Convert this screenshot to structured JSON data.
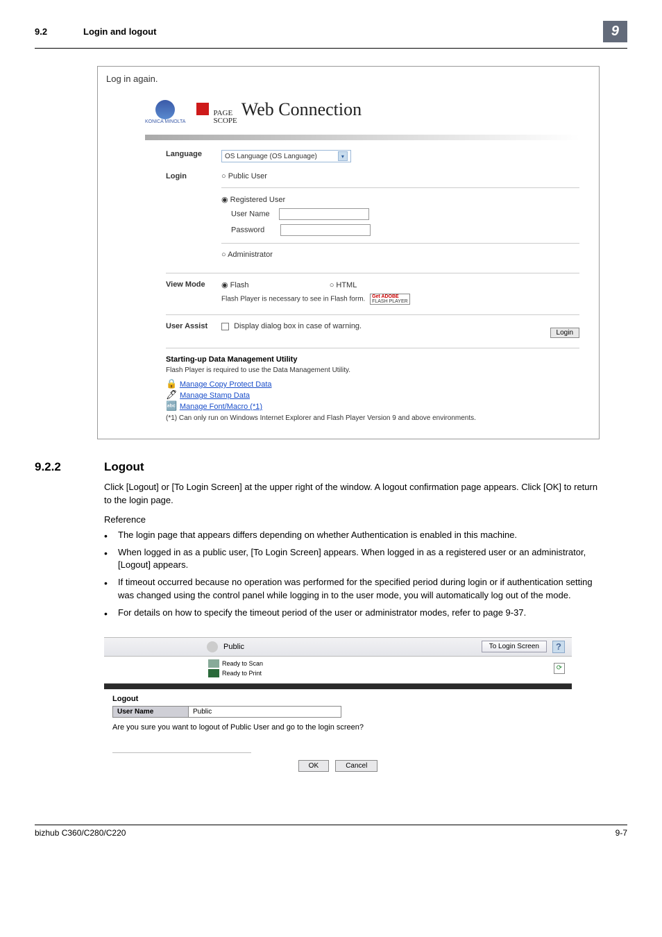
{
  "header": {
    "section_num": "9.2",
    "section_title": "Login and logout",
    "chapter": "9"
  },
  "panel1": {
    "caption": "Log in again.",
    "brand_sub": "KONICA MINOLTA",
    "brand_ps_line1": "PAGE",
    "brand_ps_line2": "SCOPE",
    "brand_wc": "Web Connection",
    "labels": {
      "language": "Language",
      "login": "Login",
      "view_mode": "View Mode",
      "user_assist": "User Assist"
    },
    "language_value": "OS Language (OS Language)",
    "login": {
      "public": "Public User",
      "registered": "Registered User",
      "user_name": "User Name",
      "password": "Password",
      "admin": "Administrator"
    },
    "view_mode": {
      "flash": "Flash",
      "html": "HTML",
      "note": "Flash Player is necessary to see in Flash form.",
      "badge1": "Get ADOBE",
      "badge2": "FLASH PLAYER"
    },
    "user_assist": {
      "checkbox_label": "Display dialog box in case of warning."
    },
    "login_btn": "Login",
    "dm": {
      "title": "Starting-up Data Management Utility",
      "note1": "Flash Player is required to use the Data Management Utility.",
      "link1": "Manage Copy Protect Data",
      "link2": "Manage Stamp Data",
      "link3": "Manage Font/Macro (*1)",
      "note2": "(*1) Can only run on Windows Internet Explorer and Flash Player Version 9 and above environments."
    }
  },
  "section": {
    "number": "9.2.2",
    "title": "Logout",
    "para1": "Click [Logout] or [To Login Screen] at the upper right of the window. A logout confirmation page appears. Click [OK] to return to the login page.",
    "reference": "Reference",
    "bullets": [
      "The login page that appears differs depending on whether Authentication is enabled in this machine.",
      "When logged in as a public user, [To Login Screen] appears. When logged in as a registered user or an administrator, [Logout] appears.",
      "If timeout occurred because no operation was performed for the specified period during login or if authentication setting was changed using the control panel while logging in to the user mode, you will automatically log out of the mode.",
      "For details on how to specify the timeout period of the user or administrator modes, refer to page 9-37."
    ]
  },
  "logout_shot": {
    "user_label": "Public",
    "to_login": "To Login Screen",
    "help": "?",
    "status_scan": "Ready to Scan",
    "status_print": "Ready to Print",
    "logout_title": "Logout",
    "un_label": "User Name",
    "un_value": "Public",
    "confirm": "Are you sure you want to logout of Public User and go to the login screen?",
    "ok": "OK",
    "cancel": "Cancel"
  },
  "footer": {
    "left": "bizhub C360/C280/C220",
    "right": "9-7"
  }
}
